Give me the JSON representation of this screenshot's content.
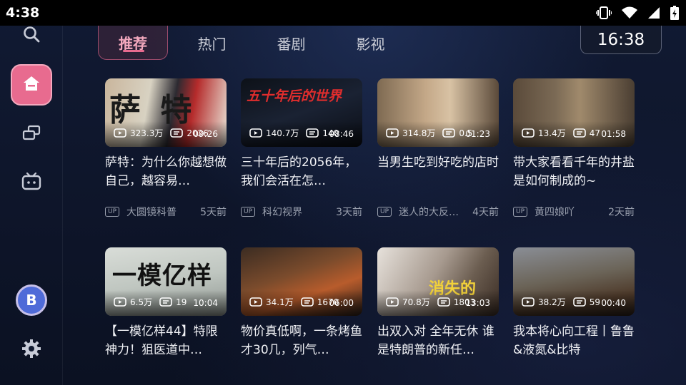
{
  "status_bar": {
    "time": "4:38"
  },
  "sidebar": {
    "avatar_letter": "B"
  },
  "tabs": [
    {
      "label": "推荐",
      "active": true
    },
    {
      "label": "热门",
      "active": false
    },
    {
      "label": "番剧",
      "active": false
    },
    {
      "label": "影视",
      "active": false
    }
  ],
  "clock": "16:38",
  "videos": [
    {
      "views": "323.3万",
      "comments": "2026",
      "duration": "09:26",
      "title": "萨特：为什么你越想做自己，越容易…",
      "uploader": "大圆镜科普",
      "age": "5天前",
      "thumb_text": "萨 特"
    },
    {
      "views": "140.7万",
      "comments": "140",
      "duration": "08:46",
      "title": "三十年后的2056年，我们会活在怎…",
      "uploader": "科幻视界",
      "age": "3天前",
      "thumb_text": "五十年后的世界"
    },
    {
      "views": "314.8万",
      "comments": "0.5",
      "duration": "01:23",
      "title": "当男生吃到好吃的店时",
      "uploader": "迷人的大反…",
      "age": "4天前",
      "thumb_text": ""
    },
    {
      "views": "13.4万",
      "comments": "47",
      "duration": "01:58",
      "title": "带大家看看千年的井盐是如何制成的~",
      "uploader": "黄四娘吖",
      "age": "2天前",
      "thumb_text": ""
    },
    {
      "views": "6.5万",
      "comments": "19",
      "duration": "10:04",
      "title": "【一模亿样44】特限神力！狙医道中…",
      "uploader": "",
      "age": "",
      "thumb_text": "一模亿样"
    },
    {
      "views": "34.1万",
      "comments": "1670",
      "duration": "06:00",
      "title": "物价真低啊，一条烤鱼才30几，列气…",
      "uploader": "",
      "age": "",
      "thumb_text": ""
    },
    {
      "views": "70.8万",
      "comments": "1803",
      "duration": "13:03",
      "title": "出双入对 全年无休 谁是特朗普的新任…",
      "uploader": "",
      "age": "",
      "thumb_text": "消失的"
    },
    {
      "views": "38.2万",
      "comments": "59",
      "duration": "00:40",
      "title": "我本将心向工程丨鲁鲁&液氮&比特",
      "uploader": "",
      "age": "",
      "thumb_text": ""
    }
  ]
}
